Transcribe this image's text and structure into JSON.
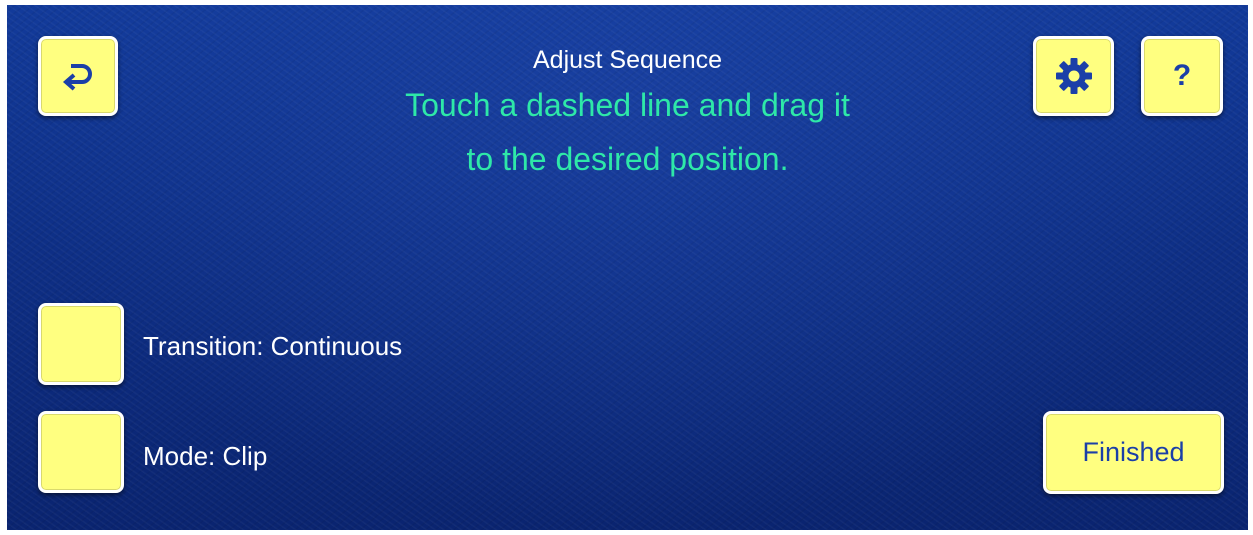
{
  "header": {
    "title": "Adjust Sequence",
    "instruction_line1": "Touch a dashed line and drag it",
    "instruction_line2": "to the desired position."
  },
  "toolbar": {
    "back_icon": "return-arrow-icon",
    "settings_icon": "gear-icon",
    "help_label": "?"
  },
  "options": {
    "transition_label": "Transition: Continuous",
    "mode_label": "Mode: Clip"
  },
  "actions": {
    "finished_label": "Finished"
  },
  "colors": {
    "background": "#0e2f86",
    "button_fill": "#ffff80",
    "button_icon": "#1b3fa8",
    "instruction_text": "#2ee8a8",
    "label_text": "#ffffff"
  }
}
